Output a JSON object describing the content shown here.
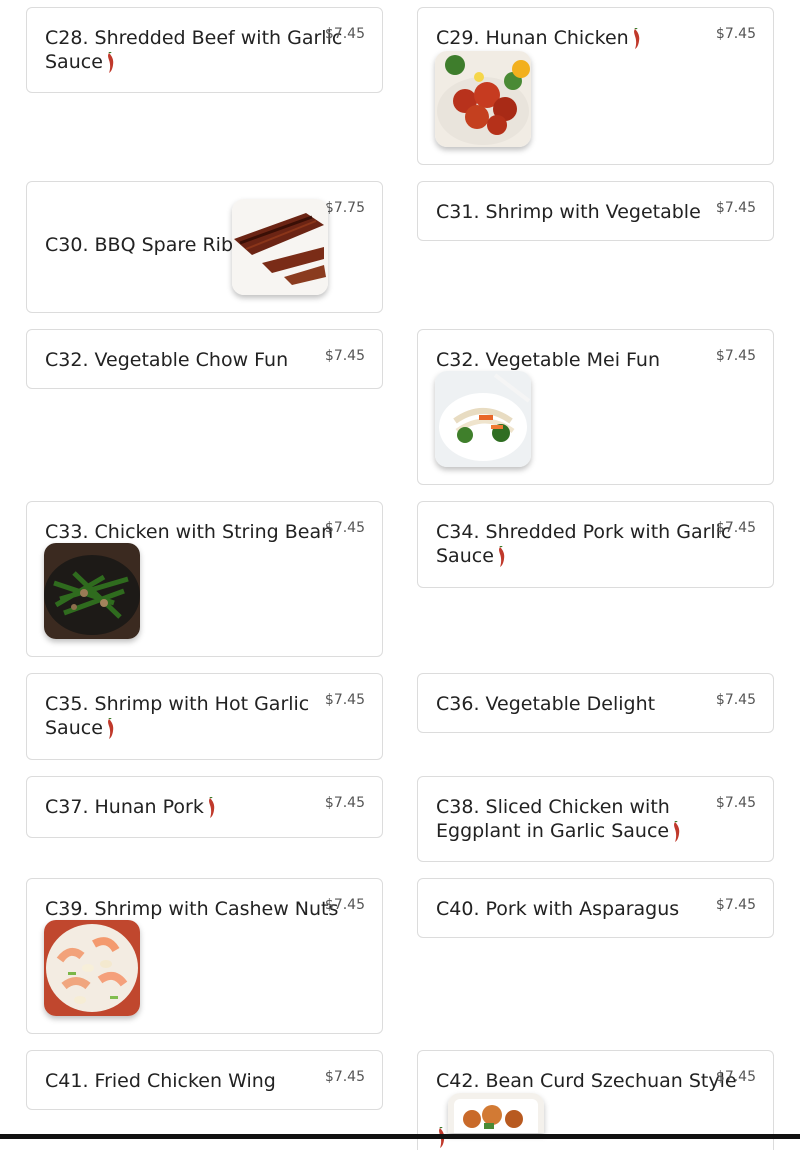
{
  "menu_items": [
    {
      "name": "C28. Shredded Beef with Garlic",
      "name2": "Sauce",
      "price": "$7.45",
      "spicy": true
    },
    {
      "name": "C29. Hunan Chicken",
      "price": "$7.45",
      "spicy": true
    },
    {
      "name": "C30. BBQ Spare Ribs",
      "price": "$7.75"
    },
    {
      "name": "C31. Shrimp with Vegetable",
      "price": "$7.45"
    },
    {
      "name": "C32. Vegetable Chow Fun",
      "price": "$7.45"
    },
    {
      "name": "C32. Vegetable Mei Fun",
      "price": "$7.45"
    },
    {
      "name": "C33. Chicken with String Bean",
      "price": "$7.45"
    },
    {
      "name": "C34. Shredded Pork with Garlic",
      "name2": "Sauce",
      "price": "$7.45",
      "spicy": true
    },
    {
      "name": "C35. Shrimp with Hot Garlic",
      "name2": "Sauce",
      "price": "$7.45",
      "spicy": true
    },
    {
      "name": "C36. Vegetable Delight",
      "price": "$7.45"
    },
    {
      "name": "C37. Hunan Pork",
      "price": "$7.45",
      "spicy": true
    },
    {
      "name": "C38. Sliced Chicken with",
      "name2": "Eggplant in Garlic Sauce",
      "price": "$7.45",
      "spicy": true
    },
    {
      "name": "C39. Shrimp with Cashew Nuts",
      "price": "$7.45"
    },
    {
      "name": "C40. Pork with Asparagus",
      "price": "$7.45"
    },
    {
      "name": "C41. Fried Chicken Wing",
      "price": "$7.45"
    },
    {
      "name": "C42. Bean Curd Szechuan Style",
      "price": "$7.45",
      "spicy": true
    }
  ],
  "icons": {
    "spicy": "chili-pepper-icon"
  },
  "colors": {
    "chili": "#c0392b",
    "border": "#dcdcdc"
  }
}
